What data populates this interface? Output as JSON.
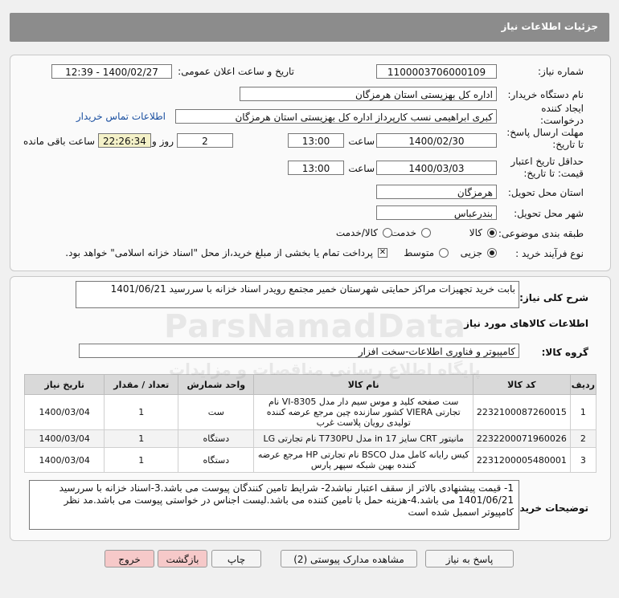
{
  "header": {
    "title": "جزئیات اطلاعات نیاز"
  },
  "form": {
    "need_number_label": "شماره نیاز:",
    "need_number": "1100003706000109",
    "announce_label": "تاریخ و ساعت اعلان عمومی:",
    "announce_value": "1400/02/27 - 12:39",
    "buyer_label": "نام دستگاه خریدار:",
    "buyer_value": "اداره کل بهزیستی استان هرمزگان",
    "creator_label": "ایجاد کننده درخواست:",
    "creator_value": "کبری  ابراهیمی نسب کارپرداز اداره کل بهزیستی استان هرمزگان",
    "contact_link": "اطلاعات تماس خریدار",
    "deadline_label": "مهلت ارسال پاسخ: تا تاریخ:",
    "deadline_date": "1400/02/30",
    "time_label": "ساعت",
    "deadline_time": "13:00",
    "days_value": "2",
    "days_label": "روز و",
    "remaining_time": "22:26:34",
    "remaining_label": "ساعت باقی مانده",
    "validity_label": "حداقل تاریخ اعتبار قیمت: تا تاریخ:",
    "validity_date": "1400/03/03",
    "validity_time": "13:00",
    "province_label": "استان محل تحویل:",
    "province_value": "هرمزگان",
    "city_label": "شهر محل تحویل:",
    "city_value": "بندرعباس",
    "category_label": "طبقه بندی موضوعی:",
    "category_options": [
      "کالا",
      "خدمت",
      "کالا/خدمت"
    ],
    "category_selected": "کالا",
    "process_label": "نوع فرآیند خرید :",
    "process_options": [
      "جزیی",
      "متوسط"
    ],
    "process_selected": "جزیی",
    "payment_note": "پرداخت تمام یا بخشی از مبلغ خرید،از محل \"اسناد خزانه اسلامی\" خواهد بود."
  },
  "summary": {
    "label": "شرح کلی نیاز:",
    "value": "بابت خرید  تجهیزات مراکز حمایتی شهرستان خمیر مجتمع رویدر اسناد خزانه با سررسید 1401/06/21",
    "goods_info_title": "اطلاعات کالاهای مورد نیاز",
    "goods_group_label": "گروه کالا:",
    "goods_group_value": "کامپیوتر و فناوری اطلاعات-سخت افزار"
  },
  "table": {
    "headers": [
      "ردیف",
      "کد کالا",
      "نام کالا",
      "واحد شمارش",
      "تعداد / مقدار",
      "تاریخ نیاز"
    ],
    "rows": [
      [
        "1",
        "2232100087260015",
        "ست صفحه کلید و موس سیم دار مدل VI-8305 نام تجارتی VIERA کشور سازنده چین مرجع عرضه کننده تولیدی رویان پلاست غرب",
        "ست",
        "1",
        "1400/03/04"
      ],
      [
        "2",
        "2232200071960026",
        "مانیتور CRT سایز 17 in مدل T730PU نام تجارتی LG",
        "دستگاه",
        "1",
        "1400/03/04"
      ],
      [
        "3",
        "2231200005480001",
        "کیس رایانه کامل مدل BSCO نام تجارتی HP مرجع عرضه کننده بهین شبکه سپهر پارس",
        "دستگاه",
        "1",
        "1400/03/04"
      ]
    ]
  },
  "notes": {
    "label": "توضیحات خریدار:",
    "value": "1- قیمت پیشنهادی بالاتر از سقف اعتبار نباشد2- شرایط تامین کنندگان پیوست می باشد.3-اسناد خزانه با سررسید 1401/06/21 می باشد.4-هزینه حمل با تامین کننده می باشد.لیست اجناس در خواستی پیوست می باشد.مد نظر کامپیوتر اسمبل شده است"
  },
  "buttons": {
    "reply": "پاسخ به نیاز",
    "attachments": "مشاهده مدارک پیوستی (2)",
    "print": "چاپ",
    "back": "بازگشت",
    "exit": "خروج"
  },
  "watermark": {
    "line1": "ParsNamadData",
    "line2": "پایگاه اطلاع رسانی مناقصات و مزایدات"
  }
}
